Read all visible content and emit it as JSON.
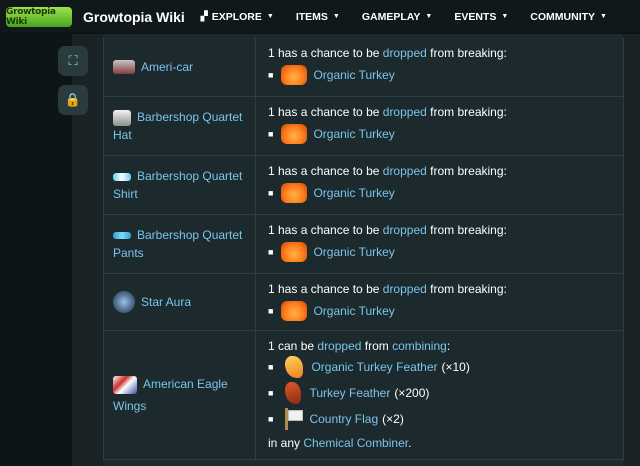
{
  "header": {
    "logo_text": "Growtopia Wiki",
    "title": "Growtopia Wiki",
    "nav": [
      {
        "label": "EXPLORE",
        "icon": "explore-icon"
      },
      {
        "label": "ITEMS"
      },
      {
        "label": "GAMEPLAY"
      },
      {
        "label": "EVENTS"
      },
      {
        "label": "COMMUNITY"
      }
    ]
  },
  "rail": {
    "buttons": [
      {
        "icon": "expand-icon"
      },
      {
        "icon": "lock-icon"
      }
    ]
  },
  "rows": [
    {
      "name": "Ameri-car",
      "text": "1 has a chance to be",
      "link": "dropped",
      "tail": "from breaking:",
      "drop": "Organic Turkey"
    },
    {
      "name": "Barbershop Quartet Hat",
      "text": "1 has a chance to be",
      "link": "dropped",
      "tail": "from breaking:",
      "drop": "Organic Turkey"
    },
    {
      "name": "Barbershop Quartet Shirt",
      "text": "1 has a chance to be",
      "link": "dropped",
      "tail": "from breaking:",
      "drop": "Organic Turkey"
    },
    {
      "name": "Barbershop Quartet Pants",
      "text": "1 has a chance to be",
      "link": "dropped",
      "tail": "from breaking:",
      "drop": "Organic Turkey"
    },
    {
      "name": "Star Aura",
      "text": "1 has a chance to be",
      "link": "dropped",
      "tail": "from breaking:",
      "drop": "Organic Turkey"
    }
  ],
  "combine_row": {
    "name": "American Eagle Wings",
    "intro_a": "1 can be",
    "intro_link": "dropped",
    "intro_b": "from",
    "intro_link2": "combining",
    "intro_c": ":",
    "ingredients": [
      {
        "name": "Organic Turkey Feather",
        "qty": "(×10)"
      },
      {
        "name": "Turkey Feather",
        "qty": "(×200)"
      },
      {
        "name": "Country Flag",
        "qty": "(×2)"
      }
    ],
    "outro_a": "in any",
    "outro_link": "Chemical Combiner",
    "outro_b": "."
  }
}
